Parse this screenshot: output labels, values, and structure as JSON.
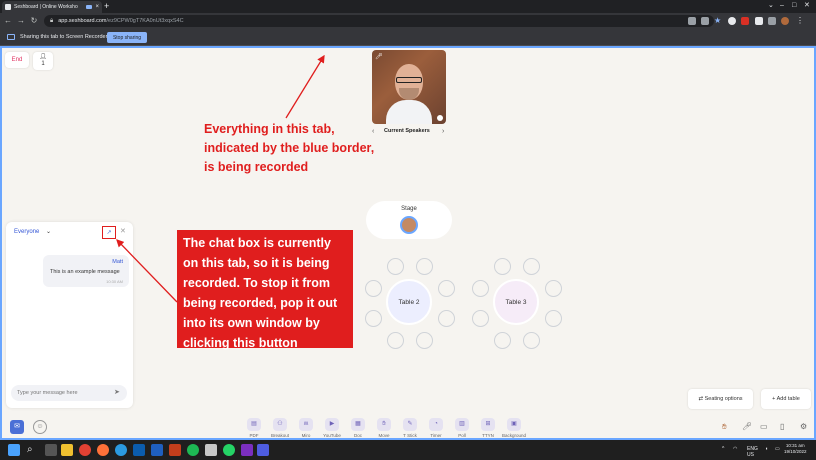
{
  "browser": {
    "tab_title": "Seshboard | Online Worksho",
    "url_host": "app.seshboard.com",
    "url_path": "/ez9CPW0gT7KA0nUt3xqxS4C",
    "sharing_text": "Sharing this tab to Screen Recorder",
    "stop_sharing_label": "Stop sharing"
  },
  "app": {
    "end_label": "End",
    "participant_count": "1",
    "speakers_label": "Current Speakers",
    "stage_label": "Stage",
    "tables": [
      {
        "label": "Table 2"
      },
      {
        "label": "Table 3"
      }
    ],
    "seating_options_label": "Seating options",
    "add_table_label": "Add table"
  },
  "chat": {
    "audience": "Everyone",
    "message": {
      "author": "Matt",
      "text": "This is an example message",
      "time": "10:30 AM"
    },
    "input_placeholder": "Type your message here"
  },
  "toolbar": {
    "tools": [
      {
        "label": "PDF",
        "icon": "pdf-icon"
      },
      {
        "label": "Breakout",
        "icon": "breakout-icon"
      },
      {
        "label": "Miro",
        "icon": "miro-icon"
      },
      {
        "label": "YouTube",
        "icon": "youtube-icon"
      },
      {
        "label": "Doc",
        "icon": "doc-icon"
      },
      {
        "label": "Move",
        "icon": "move-icon"
      },
      {
        "label": "T Stick",
        "icon": "tstick-icon"
      },
      {
        "label": "Timer",
        "icon": "timer-icon"
      },
      {
        "label": "Poll",
        "icon": "poll-icon"
      },
      {
        "label": "TTYN",
        "icon": "ttyn-icon"
      },
      {
        "label": "Background",
        "icon": "background-icon"
      }
    ]
  },
  "annotations": {
    "top": "Everything in this tab, indicated by the blue border, is being recorded",
    "chat": "The chat box is currently on this tab, so it is being recorded. To stop it from being recorded, pop it out into its own window by clicking this button"
  },
  "taskbar": {
    "lang": "ENG",
    "region": "US",
    "time": "10:31 am",
    "date": "19/10/2022"
  },
  "colors": {
    "accent": "#6aa6ff",
    "annotation_red": "#e01e1e",
    "end_pink": "#e0305f"
  }
}
